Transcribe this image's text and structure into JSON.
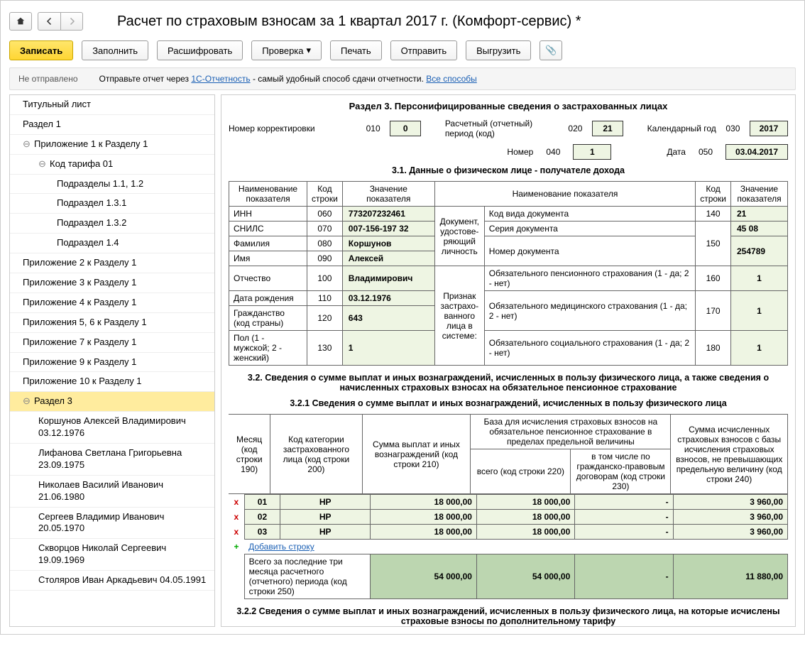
{
  "title": "Расчет по страховым взносам за 1 квартал 2017 г. (Комфорт-сервис) *",
  "toolbar": {
    "write": "Записать",
    "fill": "Заполнить",
    "decode": "Расшифровать",
    "check": "Проверка",
    "print": "Печать",
    "send": "Отправить",
    "export": "Выгрузить"
  },
  "status": {
    "state": "Не отправлено",
    "hint_pre": "Отправьте отчет через ",
    "hint_link": "1С-Отчетность",
    "hint_post": " - самый удобный способ сдачи отчетности. ",
    "hint_link2": "Все способы"
  },
  "tree": [
    {
      "l": 1,
      "t": "Титульный лист"
    },
    {
      "l": 1,
      "t": "Раздел 1"
    },
    {
      "l": 1,
      "t": "Приложение 1 к Разделу 1",
      "exp": "⊖"
    },
    {
      "l": 2,
      "t": "Код тарифа 01",
      "exp": "⊖"
    },
    {
      "l": 3,
      "t": "Подразделы 1.1, 1.2"
    },
    {
      "l": 3,
      "t": "Подраздел 1.3.1"
    },
    {
      "l": 3,
      "t": "Подраздел 1.3.2"
    },
    {
      "l": 3,
      "t": "Подраздел 1.4"
    },
    {
      "l": 1,
      "t": "Приложение 2 к Разделу 1"
    },
    {
      "l": 1,
      "t": "Приложение 3 к Разделу 1"
    },
    {
      "l": 1,
      "t": "Приложение 4 к Разделу 1"
    },
    {
      "l": 1,
      "t": "Приложения 5, 6 к Разделу 1"
    },
    {
      "l": 1,
      "t": "Приложение 7 к Разделу 1"
    },
    {
      "l": 1,
      "t": "Приложение 9 к Разделу 1"
    },
    {
      "l": 1,
      "t": "Приложение 10 к Разделу 1"
    },
    {
      "l": 1,
      "t": "Раздел 3",
      "exp": "⊖",
      "sel": true
    },
    {
      "l": 2,
      "t": "Коршунов Алексей Владимирович 03.12.1976"
    },
    {
      "l": 2,
      "t": "Лифанова Светлана Григорьевна 23.09.1975"
    },
    {
      "l": 2,
      "t": "Николаев Василий Иванович 21.06.1980"
    },
    {
      "l": 2,
      "t": "Сергеев Владимир Иванович 20.05.1970"
    },
    {
      "l": 2,
      "t": "Скворцов Николай Сергеевич 19.09.1969"
    },
    {
      "l": 2,
      "t": "Столяров Иван Аркадьевич 04.05.1991"
    }
  ],
  "sect3": {
    "title": "Раздел 3. Персонифицированные сведения о застрахованных лицах",
    "r1": {
      "corr_lbl": "Номер корректировки",
      "corr_code": "010",
      "corr_val": "0",
      "period_lbl": "Расчетный (отчетный) период (код)",
      "period_code": "020",
      "period_val": "21",
      "year_lbl": "Календарный год",
      "year_code": "030",
      "year_val": "2017"
    },
    "r2": {
      "num_lbl": "Номер",
      "num_code": "040",
      "num_val": "1",
      "date_lbl": "Дата",
      "date_code": "050",
      "date_val": "03.04.2017"
    },
    "s31_title": "3.1. Данные о физическом лице - получателе дохода",
    "t31": {
      "h_name": "Наименование показателя",
      "h_code": "Код строки",
      "h_val": "Значение показателя",
      "inn_l": "ИНН",
      "inn_c": "060",
      "inn_v": "773207232461",
      "snils_l": "СНИЛС",
      "snils_c": "070",
      "snils_v": "007-156-197 32",
      "fam_l": "Фамилия",
      "fam_c": "080",
      "fam_v": "Коршунов",
      "name_l": "Имя",
      "name_c": "090",
      "name_v": "Алексей",
      "otch_l": "Отчество",
      "otch_c": "100",
      "otch_v": "Владимирович",
      "dob_l": "Дата рождения",
      "dob_c": "110",
      "dob_v": "03.12.1976",
      "cit_l": "Гражданство (код страны)",
      "cit_c": "120",
      "cit_v": "643",
      "sex_l": "Пол (1 - мужской; 2 - женский)",
      "sex_c": "130",
      "sex_v": "1",
      "doc_l": "Документ, удостове-ряющий личность",
      "dcode_l": "Код вида документа",
      "dcode_c": "140",
      "dcode_v": "21",
      "dser_l": "Серия документа",
      "dser_v": "45 08",
      "dser_c": "150",
      "dnum_l": "Номер документа",
      "dnum_v": "254789",
      "sign_l": "Признак застрахо-ванного лица в системе:",
      "ops_l": "Обязательного пенсионного страхования (1 - да; 2 - нет)",
      "ops_c": "160",
      "ops_v": "1",
      "oms_l": "Обязательного медицинского страхования (1 - да; 2 - нет)",
      "oms_c": "170",
      "oms_v": "1",
      "oss_l": "Обязательного социального страхования (1 - да; 2 - нет)",
      "oss_c": "180",
      "oss_v": "1"
    },
    "s32_title": "3.2. Сведения о сумме выплат и иных вознаграждений, исчисленных в пользу физического лица, а также сведения о начисленных страховых взносах на обязательное пенсионное страхование",
    "s321_title": "3.2.1 Сведения о сумме выплат и иных вознаграждений, исчисленных в пользу физического лица",
    "t321_h": {
      "month": "Месяц (код строки 190)",
      "cat": "Код категории застрахованного лица (код строки 200)",
      "sum": "Сумма выплат и иных вознаграждений (код строки 210)",
      "base": "База для исчисления страховых взносов на обязательное пенсионное страхование в пределах предельной величины",
      "base_all": "всего (код строки 220)",
      "base_gp": "в том числе по гражданско-правовым договорам (код строки 230)",
      "calc": "Сумма исчисленных страховых взносов с базы исчисления страховых взносов, не превышающих предельную величину (код строки 240)"
    },
    "t321_rows": [
      {
        "m": "01",
        "cat": "НР",
        "sum": "18 000,00",
        "base": "18 000,00",
        "gp": "-",
        "calc": "3 960,00"
      },
      {
        "m": "02",
        "cat": "НР",
        "sum": "18 000,00",
        "base": "18 000,00",
        "gp": "-",
        "calc": "3 960,00"
      },
      {
        "m": "03",
        "cat": "НР",
        "sum": "18 000,00",
        "base": "18 000,00",
        "gp": "-",
        "calc": "3 960,00"
      }
    ],
    "add_row": "Добавить строку",
    "total_lbl": "Всего за последние три месяца расчетного (отчетного) периода (код строки 250)",
    "total": {
      "sum": "54 000,00",
      "base": "54 000,00",
      "gp": "-",
      "calc": "11 880,00"
    },
    "s322_title": "3.2.2 Сведения о сумме выплат и иных вознаграждений, исчисленных в пользу физического лица, на которые исчислены страховые взносы по дополнительному тарифу"
  }
}
